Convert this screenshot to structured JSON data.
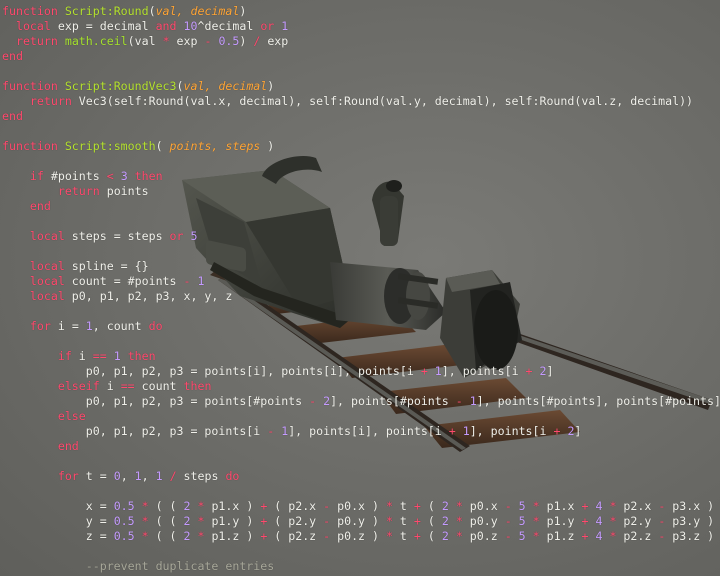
{
  "scene": {
    "background_color": "#6e6e6a",
    "object": "camera-dolly-model",
    "icons": [
      "camera-body",
      "camera-lens",
      "lens-hood",
      "camera-handle",
      "dolly-track"
    ]
  },
  "syntax_colors": {
    "keyword": "#ff4a6e",
    "function": "#b5e22f",
    "parameter": "#ffa536",
    "number": "#c59bff",
    "comment": "#a8a89a",
    "text": "#f0f0ea"
  },
  "code": {
    "lines": [
      [
        [
          "kw",
          "function "
        ],
        [
          "fn",
          "Script:Round"
        ],
        [
          "",
          "("
        ],
        [
          "prm",
          "val, decimal"
        ],
        [
          "",
          ")"
        ]
      ],
      [
        [
          "",
          "  "
        ],
        [
          "kw",
          "local"
        ],
        [
          "",
          " exp = decimal "
        ],
        [
          "kw",
          "and"
        ],
        [
          "",
          " "
        ],
        [
          "num",
          "10"
        ],
        [
          "",
          "^decimal "
        ],
        [
          "kw",
          "or"
        ],
        [
          "",
          " "
        ],
        [
          "num",
          "1"
        ]
      ],
      [
        [
          "",
          "  "
        ],
        [
          "kw",
          "return"
        ],
        [
          "",
          " "
        ],
        [
          "lib",
          "math.ceil"
        ],
        [
          "",
          "(val "
        ],
        [
          "op",
          "*"
        ],
        [
          "",
          " exp "
        ],
        [
          "op",
          "-"
        ],
        [
          "",
          " "
        ],
        [
          "num",
          "0.5"
        ],
        [
          "",
          ") "
        ],
        [
          "op",
          "/"
        ],
        [
          "",
          " exp"
        ]
      ],
      [
        [
          "kw",
          "end"
        ]
      ],
      [],
      [
        [
          "kw",
          "function "
        ],
        [
          "fn",
          "Script:RoundVec3"
        ],
        [
          "",
          "("
        ],
        [
          "prm",
          "val, decimal"
        ],
        [
          "",
          ")"
        ]
      ],
      [
        [
          "",
          "    "
        ],
        [
          "kw",
          "return"
        ],
        [
          "",
          " Vec3(self:Round(val.x, decimal), self:Round(val.y, decimal), self:Round(val.z, decimal))"
        ]
      ],
      [
        [
          "kw",
          "end"
        ]
      ],
      [],
      [
        [
          "kw",
          "function "
        ],
        [
          "fn",
          "Script:smooth"
        ],
        [
          "",
          "( "
        ],
        [
          "prm",
          "points, steps"
        ],
        [
          "",
          " )"
        ]
      ],
      [],
      [
        [
          "",
          "    "
        ],
        [
          "kw",
          "if"
        ],
        [
          "",
          " #points "
        ],
        [
          "op",
          "<"
        ],
        [
          "",
          " "
        ],
        [
          "num",
          "3"
        ],
        [
          "",
          " "
        ],
        [
          "kw",
          "then"
        ]
      ],
      [
        [
          "",
          "        "
        ],
        [
          "kw",
          "return"
        ],
        [
          "",
          " points"
        ]
      ],
      [
        [
          "",
          "    "
        ],
        [
          "kw",
          "end"
        ]
      ],
      [],
      [
        [
          "",
          "    "
        ],
        [
          "kw",
          "local"
        ],
        [
          "",
          " steps = steps "
        ],
        [
          "kw",
          "or"
        ],
        [
          "",
          " "
        ],
        [
          "num",
          "5"
        ]
      ],
      [],
      [
        [
          "",
          "    "
        ],
        [
          "kw",
          "local"
        ],
        [
          "",
          " spline = {}"
        ]
      ],
      [
        [
          "",
          "    "
        ],
        [
          "kw",
          "local"
        ],
        [
          "",
          " count = #points "
        ],
        [
          "op",
          "-"
        ],
        [
          "",
          " "
        ],
        [
          "num",
          "1"
        ]
      ],
      [
        [
          "",
          "    "
        ],
        [
          "kw",
          "local"
        ],
        [
          "",
          " p0, p1, p2, p3, x, y, z"
        ]
      ],
      [],
      [
        [
          "",
          "    "
        ],
        [
          "kw",
          "for"
        ],
        [
          "",
          " i = "
        ],
        [
          "num",
          "1"
        ],
        [
          "",
          ", count "
        ],
        [
          "kw",
          "do"
        ]
      ],
      [],
      [
        [
          "",
          "        "
        ],
        [
          "kw",
          "if"
        ],
        [
          "",
          " i "
        ],
        [
          "op",
          "=="
        ],
        [
          "",
          " "
        ],
        [
          "num",
          "1"
        ],
        [
          "",
          " "
        ],
        [
          "kw",
          "then"
        ]
      ],
      [
        [
          "",
          "            p0, p1, p2, p3 = points[i], points[i], points[i "
        ],
        [
          "op",
          "+"
        ],
        [
          "",
          " "
        ],
        [
          "num",
          "1"
        ],
        [
          "",
          "], points[i "
        ],
        [
          "op",
          "+"
        ],
        [
          "",
          " "
        ],
        [
          "num",
          "2"
        ],
        [
          "",
          "]"
        ]
      ],
      [
        [
          "",
          "        "
        ],
        [
          "kw",
          "elseif"
        ],
        [
          "",
          " i "
        ],
        [
          "op",
          "=="
        ],
        [
          "",
          " count "
        ],
        [
          "kw",
          "then"
        ]
      ],
      [
        [
          "",
          "            p0, p1, p2, p3 = points[#points "
        ],
        [
          "op",
          "-"
        ],
        [
          "",
          " "
        ],
        [
          "num",
          "2"
        ],
        [
          "",
          "], points[#points "
        ],
        [
          "op",
          "-"
        ],
        [
          "",
          " "
        ],
        [
          "num",
          "1"
        ],
        [
          "",
          "], points[#points], points[#points]"
        ]
      ],
      [
        [
          "",
          "        "
        ],
        [
          "kw",
          "else"
        ]
      ],
      [
        [
          "",
          "            p0, p1, p2, p3 = points[i "
        ],
        [
          "op",
          "-"
        ],
        [
          "",
          " "
        ],
        [
          "num",
          "1"
        ],
        [
          "",
          "], points[i], points[i "
        ],
        [
          "op",
          "+"
        ],
        [
          "",
          " "
        ],
        [
          "num",
          "1"
        ],
        [
          "",
          "], points[i "
        ],
        [
          "op",
          "+"
        ],
        [
          "",
          " "
        ],
        [
          "num",
          "2"
        ],
        [
          "",
          "]"
        ]
      ],
      [
        [
          "",
          "        "
        ],
        [
          "kw",
          "end"
        ]
      ],
      [],
      [
        [
          "",
          "        "
        ],
        [
          "kw",
          "for"
        ],
        [
          "",
          " t = "
        ],
        [
          "num",
          "0"
        ],
        [
          "",
          ", "
        ],
        [
          "num",
          "1"
        ],
        [
          "",
          ", "
        ],
        [
          "num",
          "1"
        ],
        [
          "",
          " "
        ],
        [
          "op",
          "/"
        ],
        [
          "",
          " steps "
        ],
        [
          "kw",
          "do"
        ]
      ],
      [],
      [
        [
          "",
          "            x = "
        ],
        [
          "num",
          "0.5"
        ],
        [
          "",
          " "
        ],
        [
          "op",
          "*"
        ],
        [
          "",
          " ( ( "
        ],
        [
          "num",
          "2"
        ],
        [
          "",
          " "
        ],
        [
          "op",
          "*"
        ],
        [
          "",
          " p1.x ) "
        ],
        [
          "op",
          "+"
        ],
        [
          "",
          " ( p2.x "
        ],
        [
          "op",
          "-"
        ],
        [
          "",
          " p0.x ) "
        ],
        [
          "op",
          "*"
        ],
        [
          "",
          " t "
        ],
        [
          "op",
          "+"
        ],
        [
          "",
          " ( "
        ],
        [
          "num",
          "2"
        ],
        [
          "",
          " "
        ],
        [
          "op",
          "*"
        ],
        [
          "",
          " p0.x "
        ],
        [
          "op",
          "-"
        ],
        [
          "",
          " "
        ],
        [
          "num",
          "5"
        ],
        [
          "",
          " "
        ],
        [
          "op",
          "*"
        ],
        [
          "",
          " p1.x "
        ],
        [
          "op",
          "+"
        ],
        [
          "",
          " "
        ],
        [
          "num",
          "4"
        ],
        [
          "",
          " "
        ],
        [
          "op",
          "*"
        ],
        [
          "",
          " p2.x "
        ],
        [
          "op",
          "-"
        ],
        [
          "",
          " p3.x )"
        ]
      ],
      [
        [
          "",
          "            y = "
        ],
        [
          "num",
          "0.5"
        ],
        [
          "",
          " "
        ],
        [
          "op",
          "*"
        ],
        [
          "",
          " ( ( "
        ],
        [
          "num",
          "2"
        ],
        [
          "",
          " "
        ],
        [
          "op",
          "*"
        ],
        [
          "",
          " p1.y ) "
        ],
        [
          "op",
          "+"
        ],
        [
          "",
          " ( p2.y "
        ],
        [
          "op",
          "-"
        ],
        [
          "",
          " p0.y ) "
        ],
        [
          "op",
          "*"
        ],
        [
          "",
          " t "
        ],
        [
          "op",
          "+"
        ],
        [
          "",
          " ( "
        ],
        [
          "num",
          "2"
        ],
        [
          "",
          " "
        ],
        [
          "op",
          "*"
        ],
        [
          "",
          " p0.y "
        ],
        [
          "op",
          "-"
        ],
        [
          "",
          " "
        ],
        [
          "num",
          "5"
        ],
        [
          "",
          " "
        ],
        [
          "op",
          "*"
        ],
        [
          "",
          " p1.y "
        ],
        [
          "op",
          "+"
        ],
        [
          "",
          " "
        ],
        [
          "num",
          "4"
        ],
        [
          "",
          " "
        ],
        [
          "op",
          "*"
        ],
        [
          "",
          " p2.y "
        ],
        [
          "op",
          "-"
        ],
        [
          "",
          " p3.y )"
        ]
      ],
      [
        [
          "",
          "            z = "
        ],
        [
          "num",
          "0.5"
        ],
        [
          "",
          " "
        ],
        [
          "op",
          "*"
        ],
        [
          "",
          " ( ( "
        ],
        [
          "num",
          "2"
        ],
        [
          "",
          " "
        ],
        [
          "op",
          "*"
        ],
        [
          "",
          " p1.z ) "
        ],
        [
          "op",
          "+"
        ],
        [
          "",
          " ( p2.z "
        ],
        [
          "op",
          "-"
        ],
        [
          "",
          " p0.z ) "
        ],
        [
          "op",
          "*"
        ],
        [
          "",
          " t "
        ],
        [
          "op",
          "+"
        ],
        [
          "",
          " ( "
        ],
        [
          "num",
          "2"
        ],
        [
          "",
          " "
        ],
        [
          "op",
          "*"
        ],
        [
          "",
          " p0.z "
        ],
        [
          "op",
          "-"
        ],
        [
          "",
          " "
        ],
        [
          "num",
          "5"
        ],
        [
          "",
          " "
        ],
        [
          "op",
          "*"
        ],
        [
          "",
          " p1.z "
        ],
        [
          "op",
          "+"
        ],
        [
          "",
          " "
        ],
        [
          "num",
          "4"
        ],
        [
          "",
          " "
        ],
        [
          "op",
          "*"
        ],
        [
          "",
          " p2.z "
        ],
        [
          "op",
          "-"
        ],
        [
          "",
          " p3.z )"
        ]
      ],
      [],
      [
        [
          "",
          "            "
        ],
        [
          "cm",
          "--prevent duplicate entries"
        ]
      ]
    ]
  }
}
